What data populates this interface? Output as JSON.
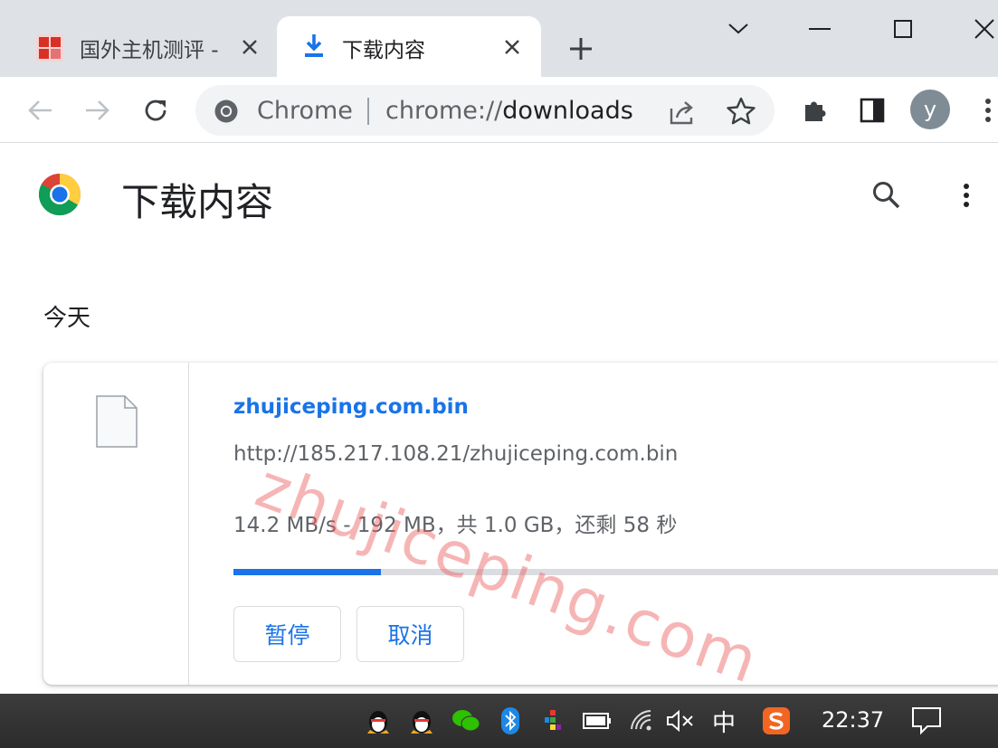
{
  "tabs": [
    {
      "title": "国外主机测评 - ",
      "favicon": "site-favicon",
      "active": false
    },
    {
      "title": "下载内容",
      "favicon": "download-icon",
      "active": true
    }
  ],
  "toolbar": {
    "omnibox_chip": "Chrome",
    "url_scheme": "chrome://",
    "url_host": "downloads",
    "avatar_letter": "y"
  },
  "page": {
    "title": "下载内容",
    "date_group": "今天",
    "watermark": "zhujiceping.com"
  },
  "download": {
    "file_name": "zhujiceping.com.bin",
    "url": "http://185.217.108.21/zhujiceping.com.bin",
    "status": "14.2 MB/s - 192 MB，共 1.0 GB，还剩 58 秒",
    "progress_fraction": 0.1875,
    "pause_label": "暂停",
    "cancel_label": "取消"
  },
  "taskbar": {
    "clock": "22:37",
    "ime": "中"
  },
  "colors": {
    "accent": "#1a73e8",
    "tabstrip": "#dee1e6",
    "watermark": "#ec5a5a"
  }
}
